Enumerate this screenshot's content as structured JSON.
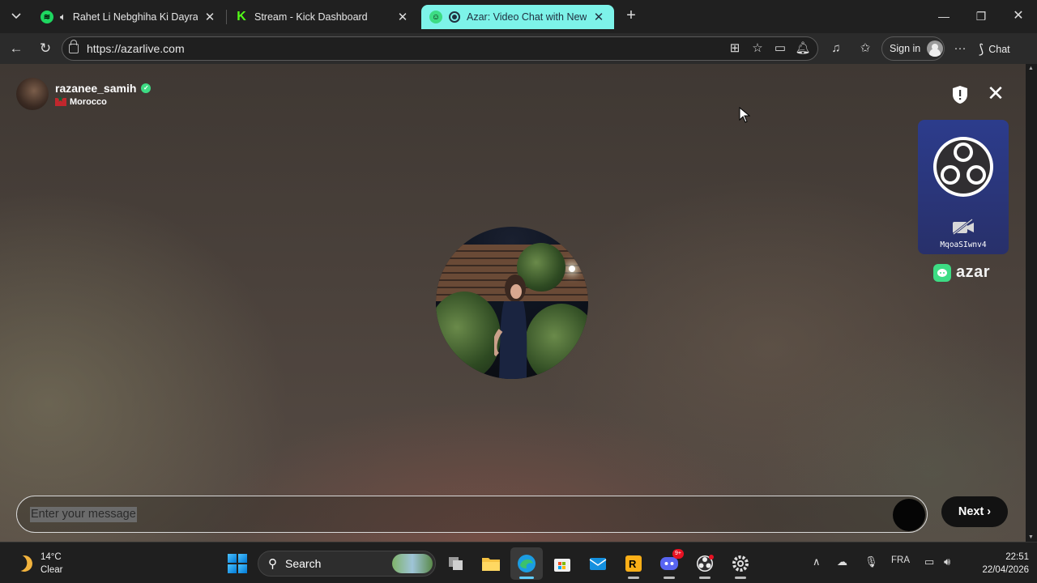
{
  "browser": {
    "tabs": [
      {
        "title": "Rahet Li Nebghiha Ki Dayra Hbal",
        "favicon": "spotify-icon",
        "audio": true
      },
      {
        "title": "Stream - Kick Dashboard",
        "favicon": "kick-icon"
      },
      {
        "title": "Azar: Video Chat with New People",
        "favicon": "azar-icon",
        "recording": true,
        "active": true
      }
    ],
    "url": "https://azarlive.com",
    "sign_in_label": "Sign in",
    "chat_label": "Chat"
  },
  "peer": {
    "username": "razanee_samih",
    "country": "Morocco",
    "verified": true
  },
  "self_view": {
    "label": "MqoaSIwnv4",
    "camera": "off"
  },
  "brand": {
    "name": "azar",
    "accent_color": "#3ddc84"
  },
  "message": {
    "placeholder": "Enter your message"
  },
  "next_label": "Next",
  "taskbar": {
    "weather_temp": "14°C",
    "weather_desc": "Clear",
    "search_label": "Search",
    "language": "FRA",
    "time": "22:51",
    "date": "22/04/2026",
    "discord_badge": "9+"
  }
}
